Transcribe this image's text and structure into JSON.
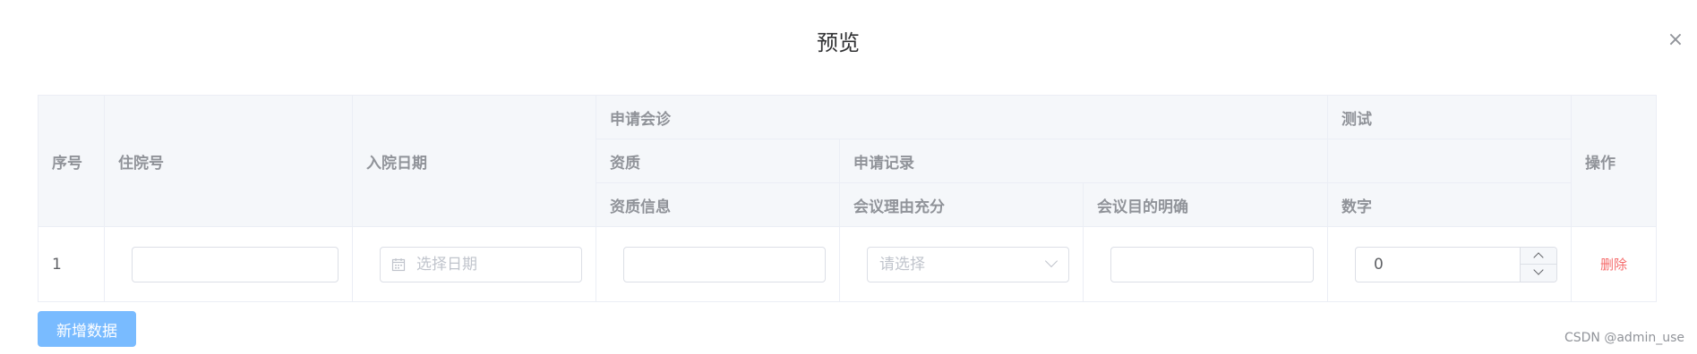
{
  "dialog": {
    "title": "预览",
    "close_glyph": "×"
  },
  "table": {
    "headers": {
      "index": "序号",
      "admission_no": "住院号",
      "admission_date": "入院日期",
      "group_consult": "申请会诊",
      "group_test": "测试",
      "qualification": "资质",
      "apply_record": "申请记录",
      "qualification_info": "资质信息",
      "meeting_reason": "会议理由充分",
      "meeting_purpose": "会议目的明确",
      "number": "数字",
      "action": "操作"
    },
    "rows": [
      {
        "index": "1",
        "admission_no_value": "",
        "admission_date_placeholder": "选择日期",
        "qualification_info_value": "",
        "meeting_reason_placeholder": "请选择",
        "meeting_purpose_value": "",
        "number_value": "0",
        "delete_label": "删除"
      }
    ]
  },
  "footer": {
    "add_button": "新增数据",
    "watermark": "CSDN @admin_use"
  },
  "colors": {
    "header_bg": "#f5f7fa",
    "border": "#ebeef5",
    "primary_light": "#79bbff",
    "danger": "#f56c6c"
  }
}
